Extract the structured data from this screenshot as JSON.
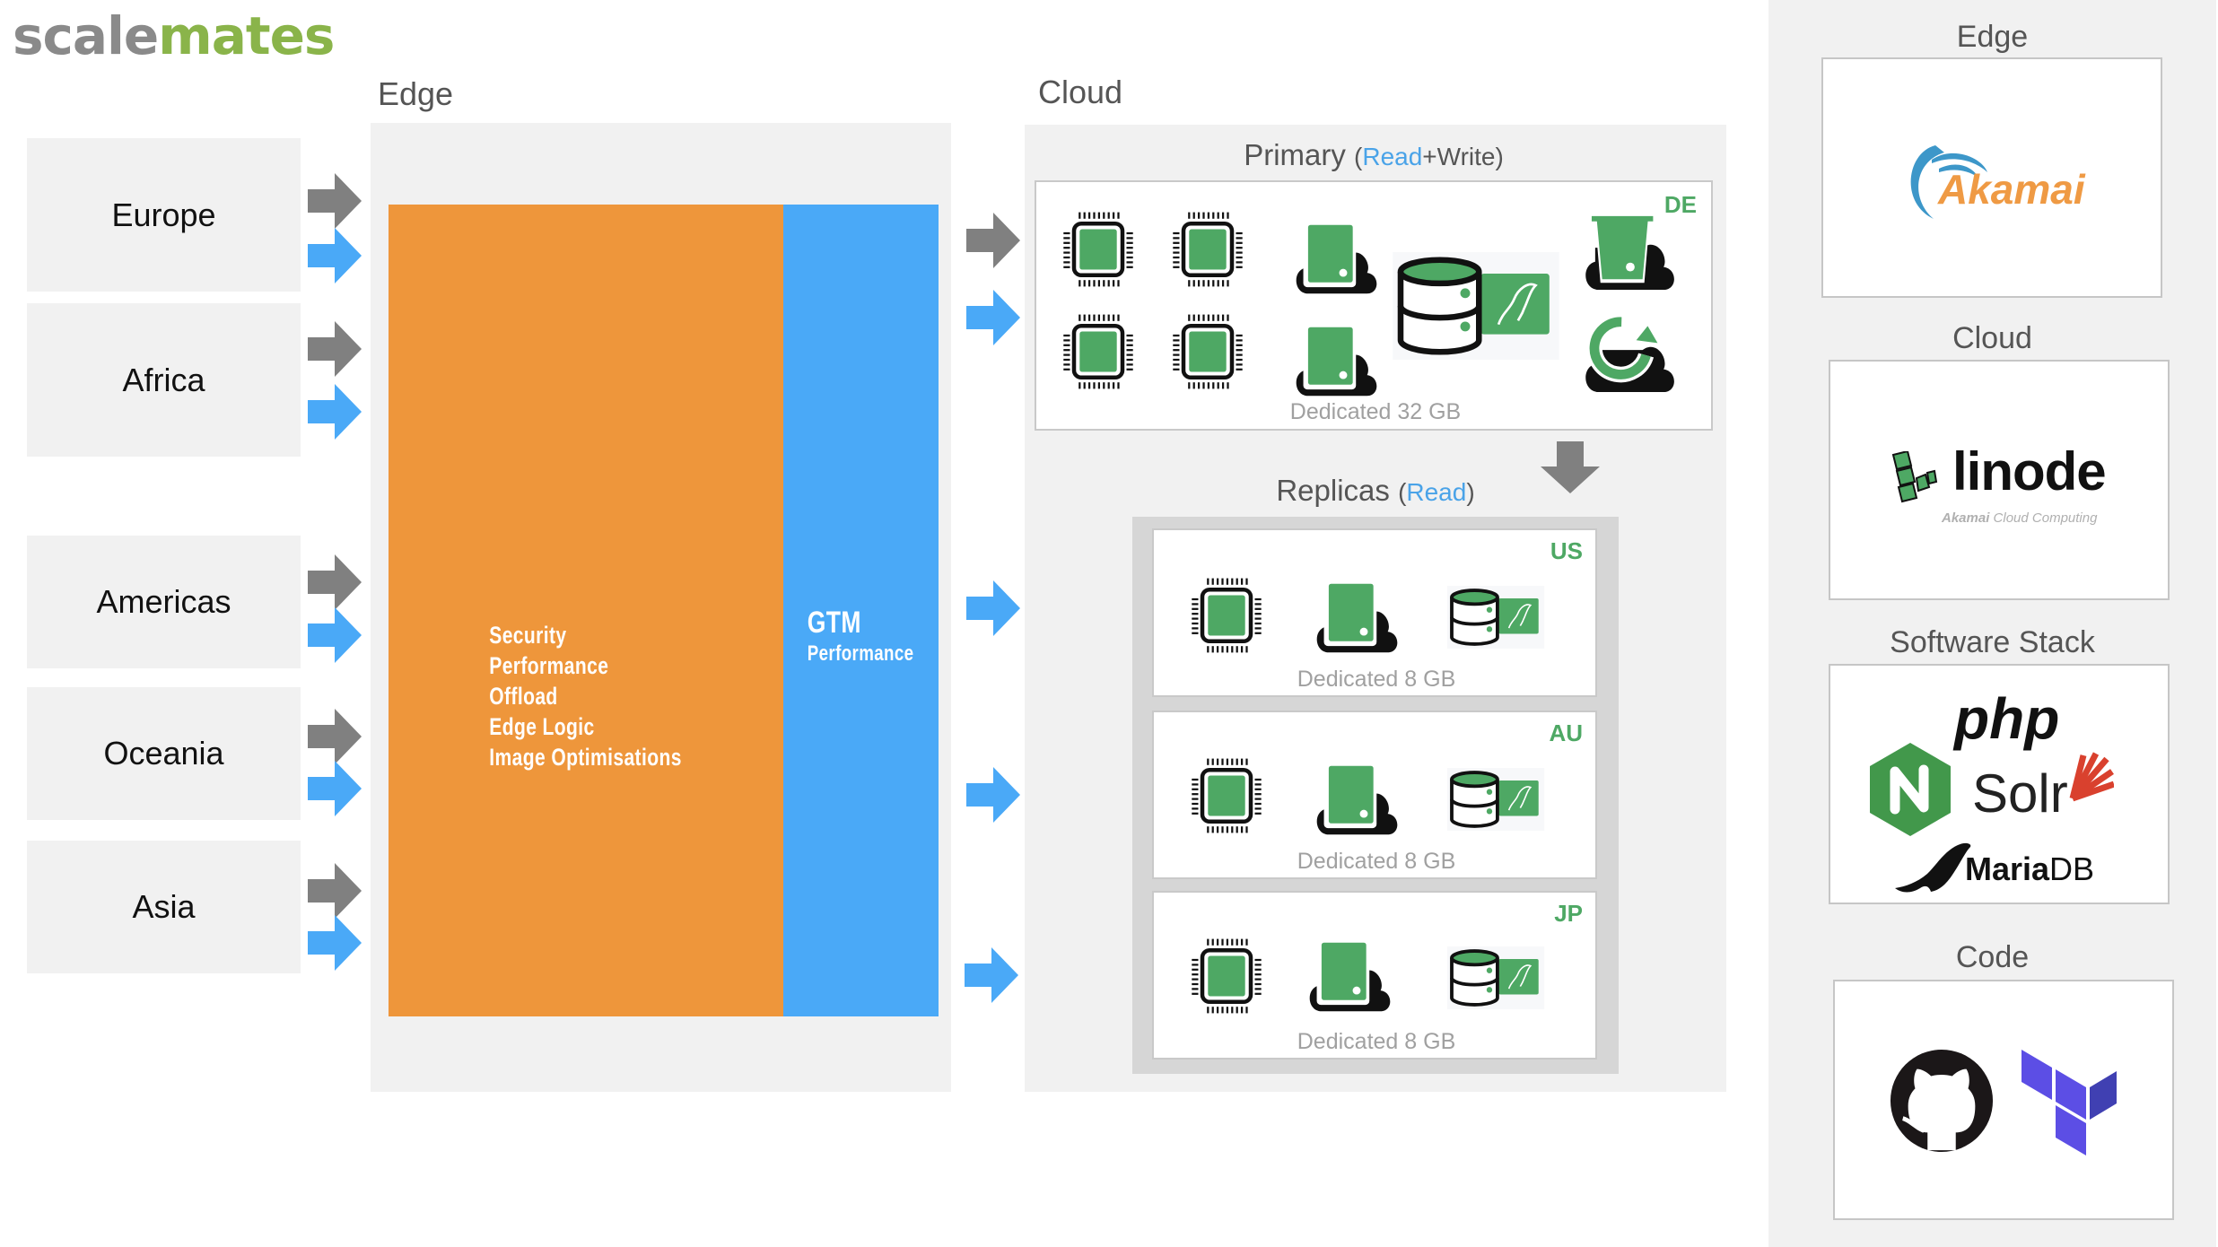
{
  "logo": {
    "part1": "scale",
    "part2": "mates"
  },
  "sections": {
    "edge": "Edge",
    "cloud": "Cloud"
  },
  "regions": [
    {
      "name": "Europe"
    },
    {
      "name": "Africa"
    },
    {
      "name": "Americas"
    },
    {
      "name": "Oceania"
    },
    {
      "name": "Asia"
    }
  ],
  "edge_layer": {
    "features": [
      "Security",
      "Performance",
      "Offload",
      "Edge Logic",
      "Image Optimisations"
    ],
    "gtm_title": "GTM",
    "gtm_subtitle": "Performance"
  },
  "primary": {
    "title": "Primary",
    "paren_open": "(",
    "read": "Read",
    "write": "+Write)",
    "region_code": "DE",
    "caption": "Dedicated 32 GB",
    "icons": [
      "cpu-icon",
      "cpu-icon",
      "cpu-icon",
      "cpu-icon",
      "cloud-volume-icon",
      "cloud-volume-icon",
      "mysql-database-icon",
      "object-storage-icon",
      "cloud-backup-icon"
    ]
  },
  "replicas": {
    "title": "Replicas",
    "paren_open": "(",
    "read": "Read",
    "paren_close": ")",
    "items": [
      {
        "region_code": "US",
        "caption": "Dedicated 8 GB"
      },
      {
        "region_code": "AU",
        "caption": "Dedicated 8 GB"
      },
      {
        "region_code": "JP",
        "caption": "Dedicated 8 GB"
      }
    ]
  },
  "legend": {
    "edge": {
      "label": "Edge",
      "logo_text": "Akamai"
    },
    "cloud": {
      "label": "Cloud",
      "logo_text": "linode",
      "logo_sub_bold": "Akamai",
      "logo_sub": "Cloud Computing"
    },
    "software": {
      "label": "Software Stack",
      "php": "php",
      "solr": "Solr",
      "mariadb_bold": "Maria",
      "mariadb": "DB",
      "nginx": "N"
    },
    "code": {
      "label": "Code",
      "icons": [
        "github-icon",
        "terraform-icon"
      ]
    }
  },
  "colors": {
    "orange": "#ee963b",
    "blue": "#4aa9f7",
    "green": "#4ea864",
    "arrow_gray": "#808080",
    "panel": "#f1f1f1",
    "brand_gray": "#8a8a8a",
    "brand_green": "#8ab44a"
  }
}
